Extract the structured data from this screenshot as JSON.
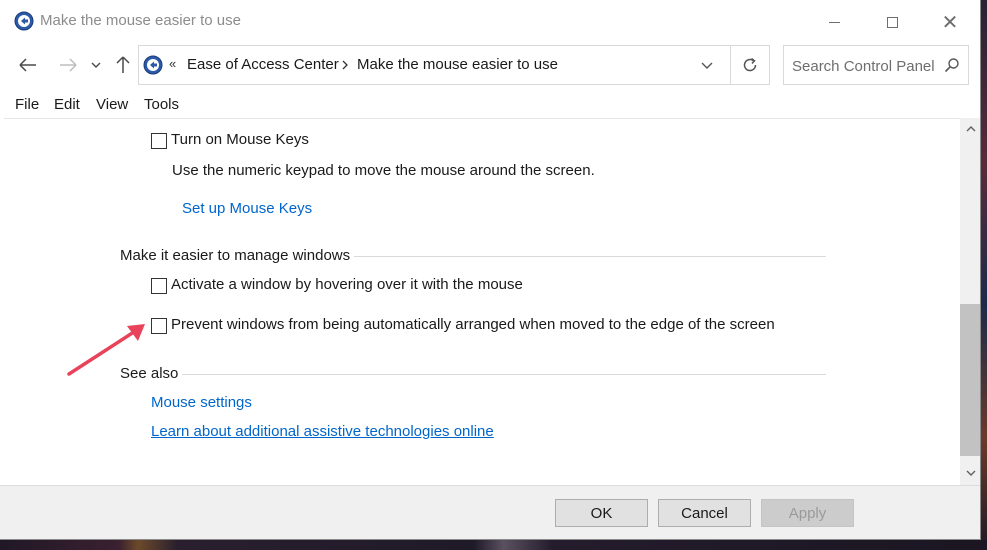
{
  "window": {
    "title": "Make the mouse easier to use"
  },
  "address": {
    "overflow_glyph": "«",
    "crumbs": [
      "Ease of Access Center",
      "Make the mouse easier to use"
    ]
  },
  "search": {
    "placeholder": "Search Control Panel"
  },
  "menubar": {
    "items": [
      "File",
      "Edit",
      "View",
      "Tools"
    ]
  },
  "content": {
    "mouse_keys": {
      "label": "Turn on Mouse Keys",
      "checked": false,
      "description": "Use the numeric keypad to move the mouse around the screen.",
      "link": "Set up Mouse Keys"
    },
    "windows_section": {
      "heading": "Make it easier to manage windows",
      "options": [
        {
          "label": "Activate a window by hovering over it with the mouse",
          "checked": false
        },
        {
          "label": "Prevent windows from being automatically arranged when moved to the edge of the screen",
          "checked": false
        }
      ]
    },
    "see_also": {
      "heading": "See also",
      "links": [
        "Mouse settings",
        "Learn about additional assistive technologies online"
      ]
    }
  },
  "footer": {
    "ok_label": "OK",
    "cancel_label": "Cancel",
    "apply_label": "Apply"
  },
  "colors": {
    "link": "#0066cc",
    "annotation_arrow": "#e8435a"
  },
  "icons": {
    "app": "ease-of-access-icon",
    "back": "arrow-left-icon",
    "forward": "arrow-right-icon",
    "up": "arrow-up-icon",
    "refresh": "refresh-icon",
    "search": "search-icon"
  }
}
